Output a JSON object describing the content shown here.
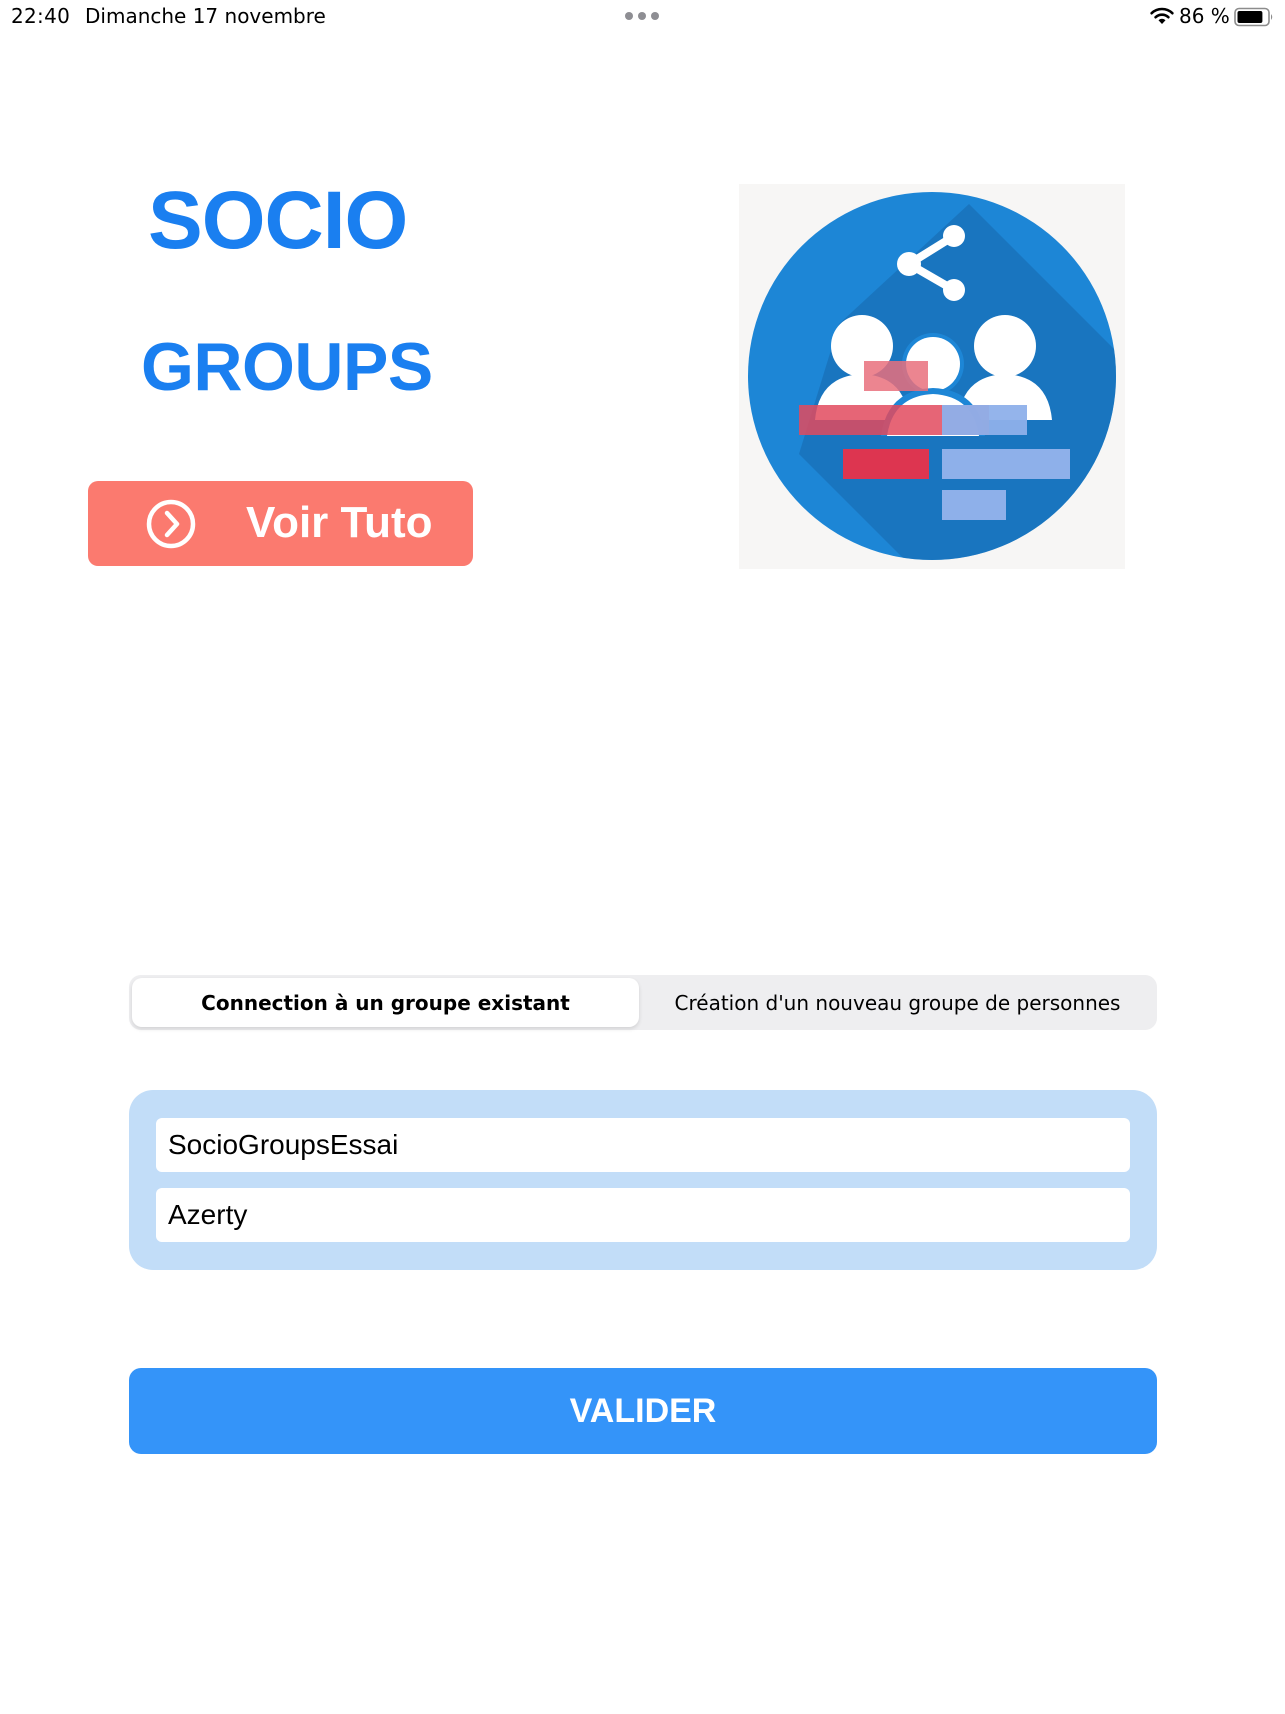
{
  "status_bar": {
    "time": "22:40",
    "date": "Dimanche 17 novembre",
    "battery_percent": "86 %",
    "battery_level": 0.86,
    "icons": [
      "more-dots-icon",
      "wifi-icon",
      "battery-icon"
    ]
  },
  "brand": {
    "line1": "SOCIO",
    "line2": "GROUPS",
    "color": "#1a7ff0"
  },
  "tuto_button": {
    "label": "Voir Tuto",
    "icon": "chevron-right-circle-icon",
    "color": "#fb7a6f"
  },
  "logo": {
    "icon": "socio-groups-logo"
  },
  "segmented_control": {
    "options": [
      {
        "label": "Connection à un groupe existant",
        "selected": true
      },
      {
        "label": "Création d'un nouveau groupe de personnes",
        "selected": false
      }
    ]
  },
  "credentials": {
    "group_name_value": "SocioGroupsEssai",
    "password_value": "Azerty",
    "panel_color": "#c2ddf8"
  },
  "validate_button": {
    "label": "VALIDER",
    "color": "#3494f9"
  }
}
